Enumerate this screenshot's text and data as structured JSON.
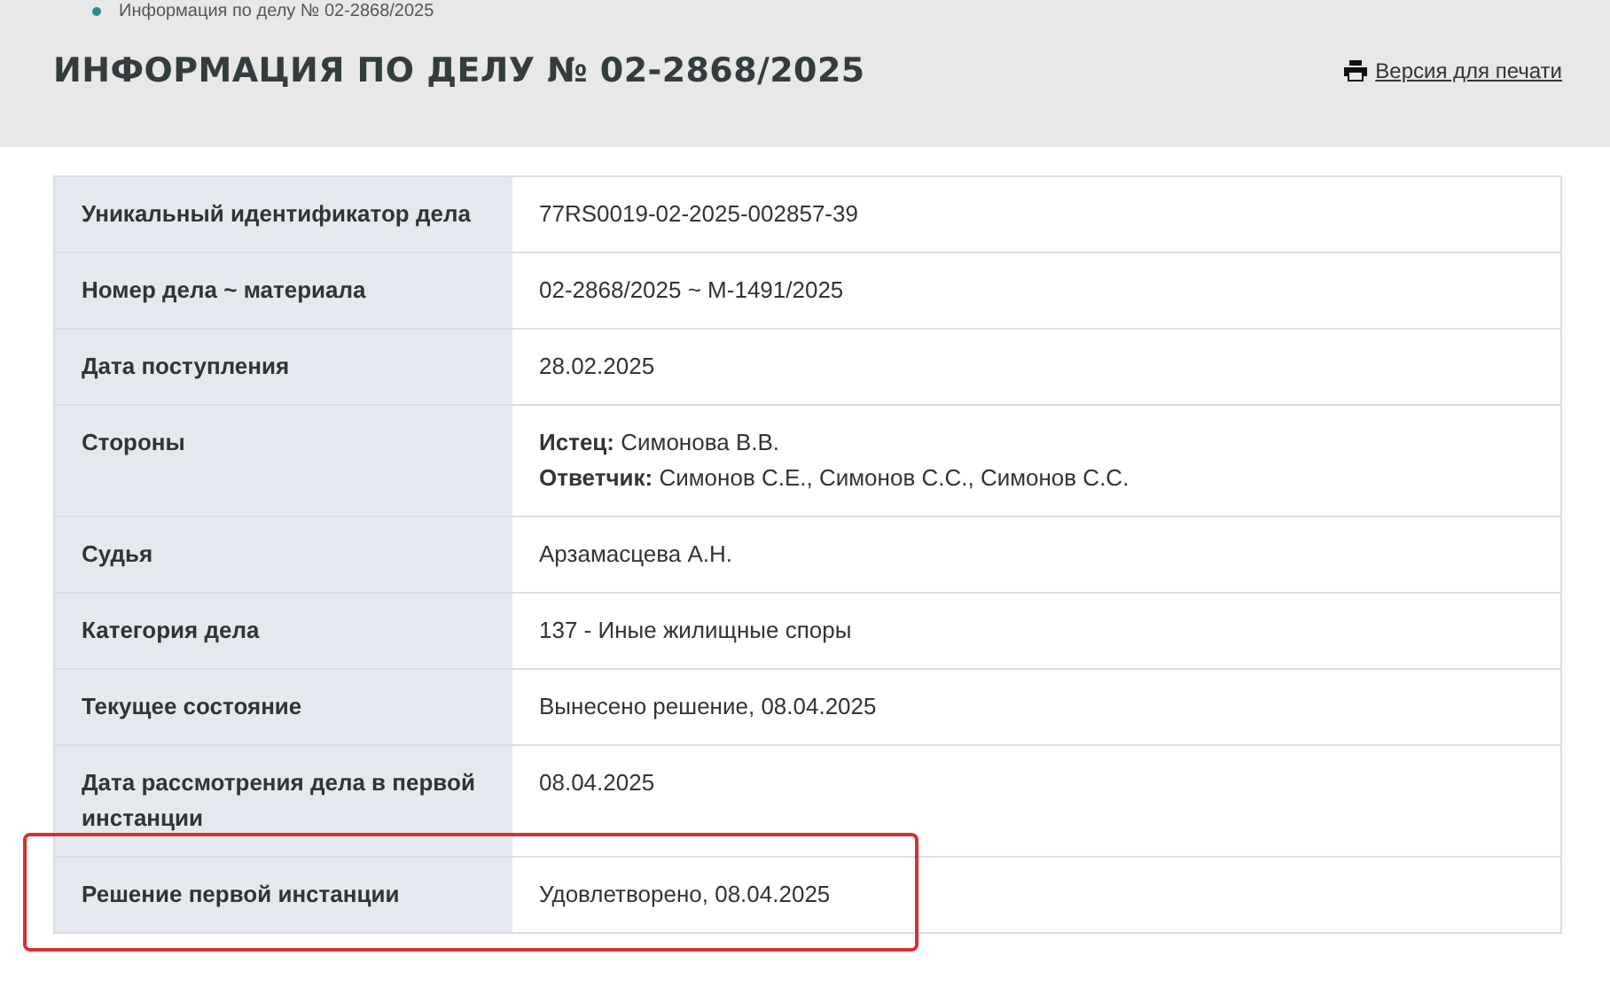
{
  "breadcrumb": {
    "text": "Информация по делу № 02-2868/2025"
  },
  "header": {
    "title": "ИНФОРМАЦИЯ ПО ДЕЛУ № 02-2868/2025",
    "print_link": "Версия для печати"
  },
  "table": {
    "rows": [
      {
        "label": "Уникальный идентификатор дела",
        "lines": [
          "77RS0019-02-2025-002857-39"
        ],
        "highlighted": false
      },
      {
        "label": "Номер дела ~ материала",
        "lines": [
          "02-2868/2025 ~ М-1491/2025"
        ],
        "highlighted": false
      },
      {
        "label": "Дата поступления",
        "lines": [
          "28.02.2025"
        ],
        "highlighted": false
      },
      {
        "label": "Стороны",
        "lines": [
          "**Истец:** Симонова В.В.",
          "**Ответчик:** Симонов С.Е., Симонов С.С., Симонов С.С."
        ],
        "highlighted": false
      },
      {
        "label": "Судья",
        "lines": [
          "Арзамасцева А.Н."
        ],
        "highlighted": false
      },
      {
        "label": "Категория дела",
        "lines": [
          "137 - Иные жилищные споры"
        ],
        "highlighted": false
      },
      {
        "label": "Текущее состояние",
        "lines": [
          "Вынесено решение, 08.04.2025"
        ],
        "highlighted": false
      },
      {
        "label": "Дата рассмотрения дела в первой инстанции",
        "lines": [
          "08.04.2025"
        ],
        "highlighted": false
      },
      {
        "label": "Решение первой инстанции",
        "lines": [
          "Удовлетворено, 08.04.2025"
        ],
        "highlighted": true
      }
    ]
  }
}
